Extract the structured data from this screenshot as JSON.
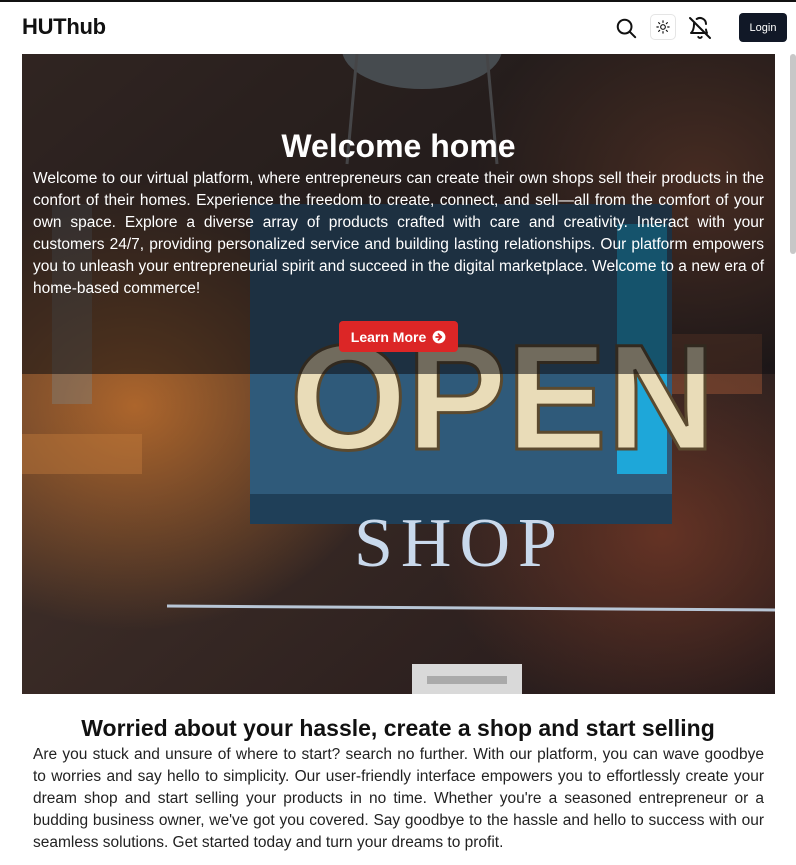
{
  "header": {
    "brand": "HUThub",
    "login_label": "Login"
  },
  "icons": {
    "search": "search-icon",
    "theme": "sun-icon",
    "notifications": "bell-off-icon",
    "cta_arrow": "arrow-circle-right-icon"
  },
  "hero": {
    "title": "Welcome home",
    "body": "Welcome to our virtual platform, where entrepreneurs can create their own shops sell their products in the confort of their homes. Experience the freedom to create, connect, and sell—all from the comfort of your own space. Explore a diverse array of products crafted with care and creativity. Interact with your customers 24/7, providing personalized service and building lasting relationships. Our platform empowers you to unleash your entrepreneurial spirit and succeed in the digital marketplace. Welcome to a new era of home-based commerce!",
    "cta_label": "Learn More",
    "sign_text_top": "OPEN",
    "sign_text_bottom": "SHOP"
  },
  "section": {
    "title": "Worried about your hassle, create a shop and start selling",
    "body": "Are you stuck and unsure of where to start? search no further. With our platform, you can wave goodbye to worries and say hello to simplicity. Our user-friendly interface empowers you to effortlessly create your dream shop and start selling your products in no time. Whether you're a seasoned entrepreneur or a budding business owner, we've got you covered. Say goodbye to the hassle and hello to success with our seamless solutions. Get started today and turn your dreams to profit."
  },
  "colors": {
    "accent": "#dc2626",
    "login_bg": "#111827"
  }
}
